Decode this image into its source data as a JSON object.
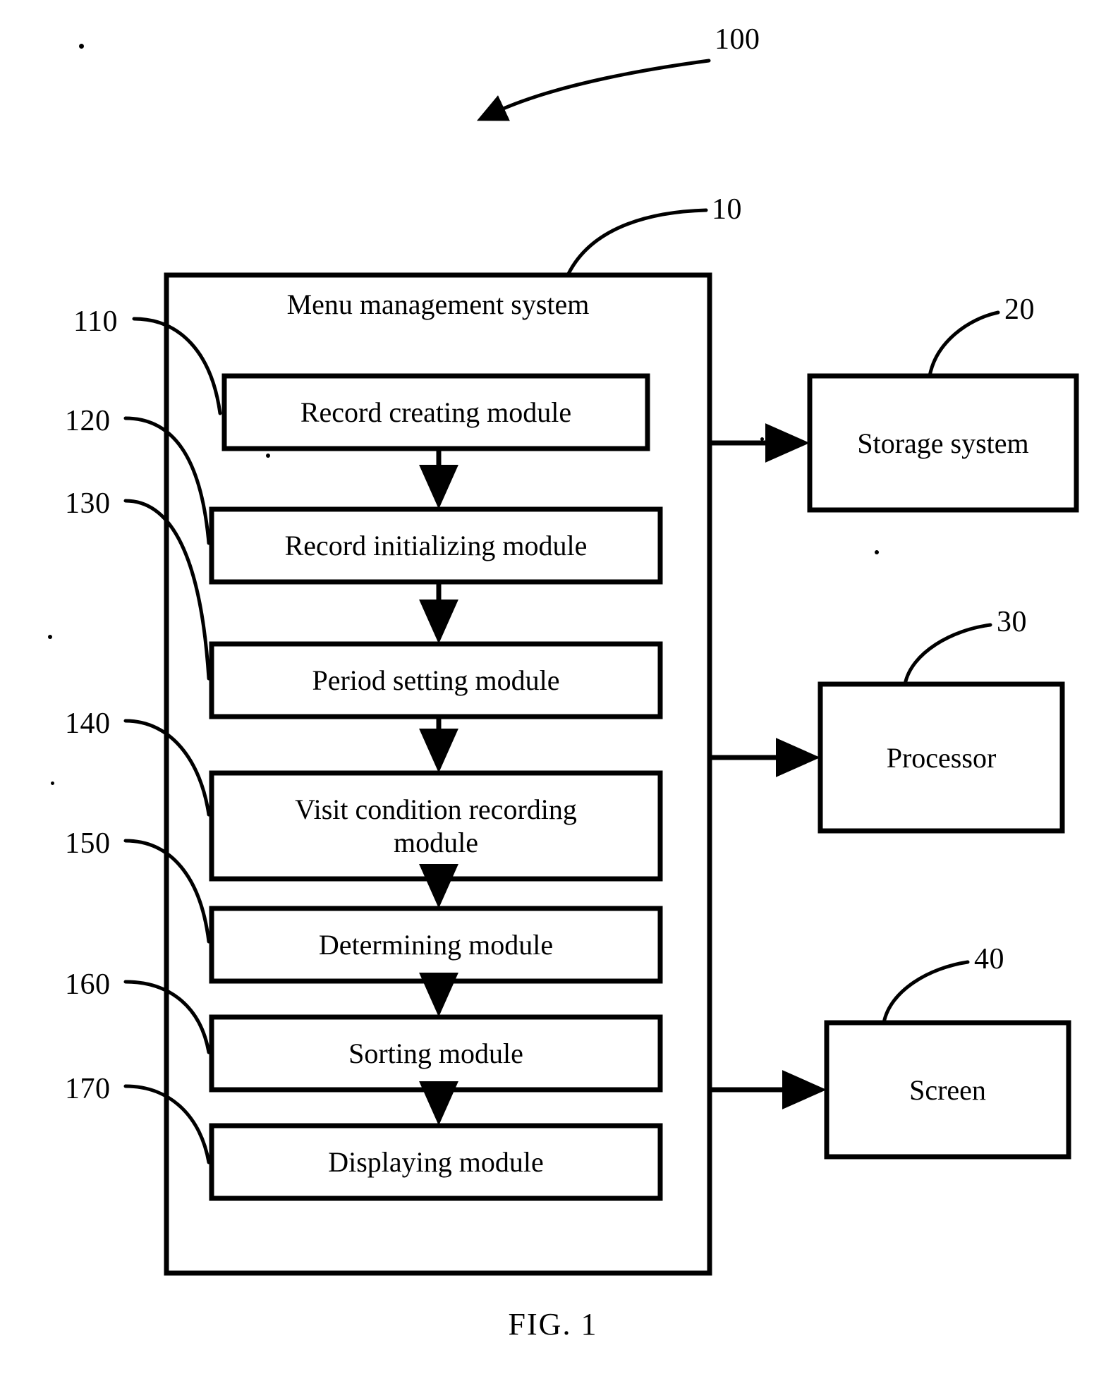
{
  "figure": {
    "caption": "FIG. 1",
    "top_numeral": "100",
    "system_numeral": "10"
  },
  "system": {
    "title": "Menu management system",
    "modules": [
      {
        "numeral": "110",
        "label": "Record creating module"
      },
      {
        "numeral": "120",
        "label": "Record initializing module"
      },
      {
        "numeral": "130",
        "label": "Period setting module"
      },
      {
        "numeral": "140",
        "label": "Visit condition recording\nmodule"
      },
      {
        "numeral": "150",
        "label": "Determining module"
      },
      {
        "numeral": "160",
        "label": "Sorting module"
      },
      {
        "numeral": "170",
        "label": "Displaying module"
      }
    ]
  },
  "peripherals": [
    {
      "numeral": "20",
      "label": "Storage system"
    },
    {
      "numeral": "30",
      "label": "Processor"
    },
    {
      "numeral": "40",
      "label": "Screen"
    }
  ],
  "colors": {
    "ink": "#000000",
    "paper": "#ffffff"
  }
}
